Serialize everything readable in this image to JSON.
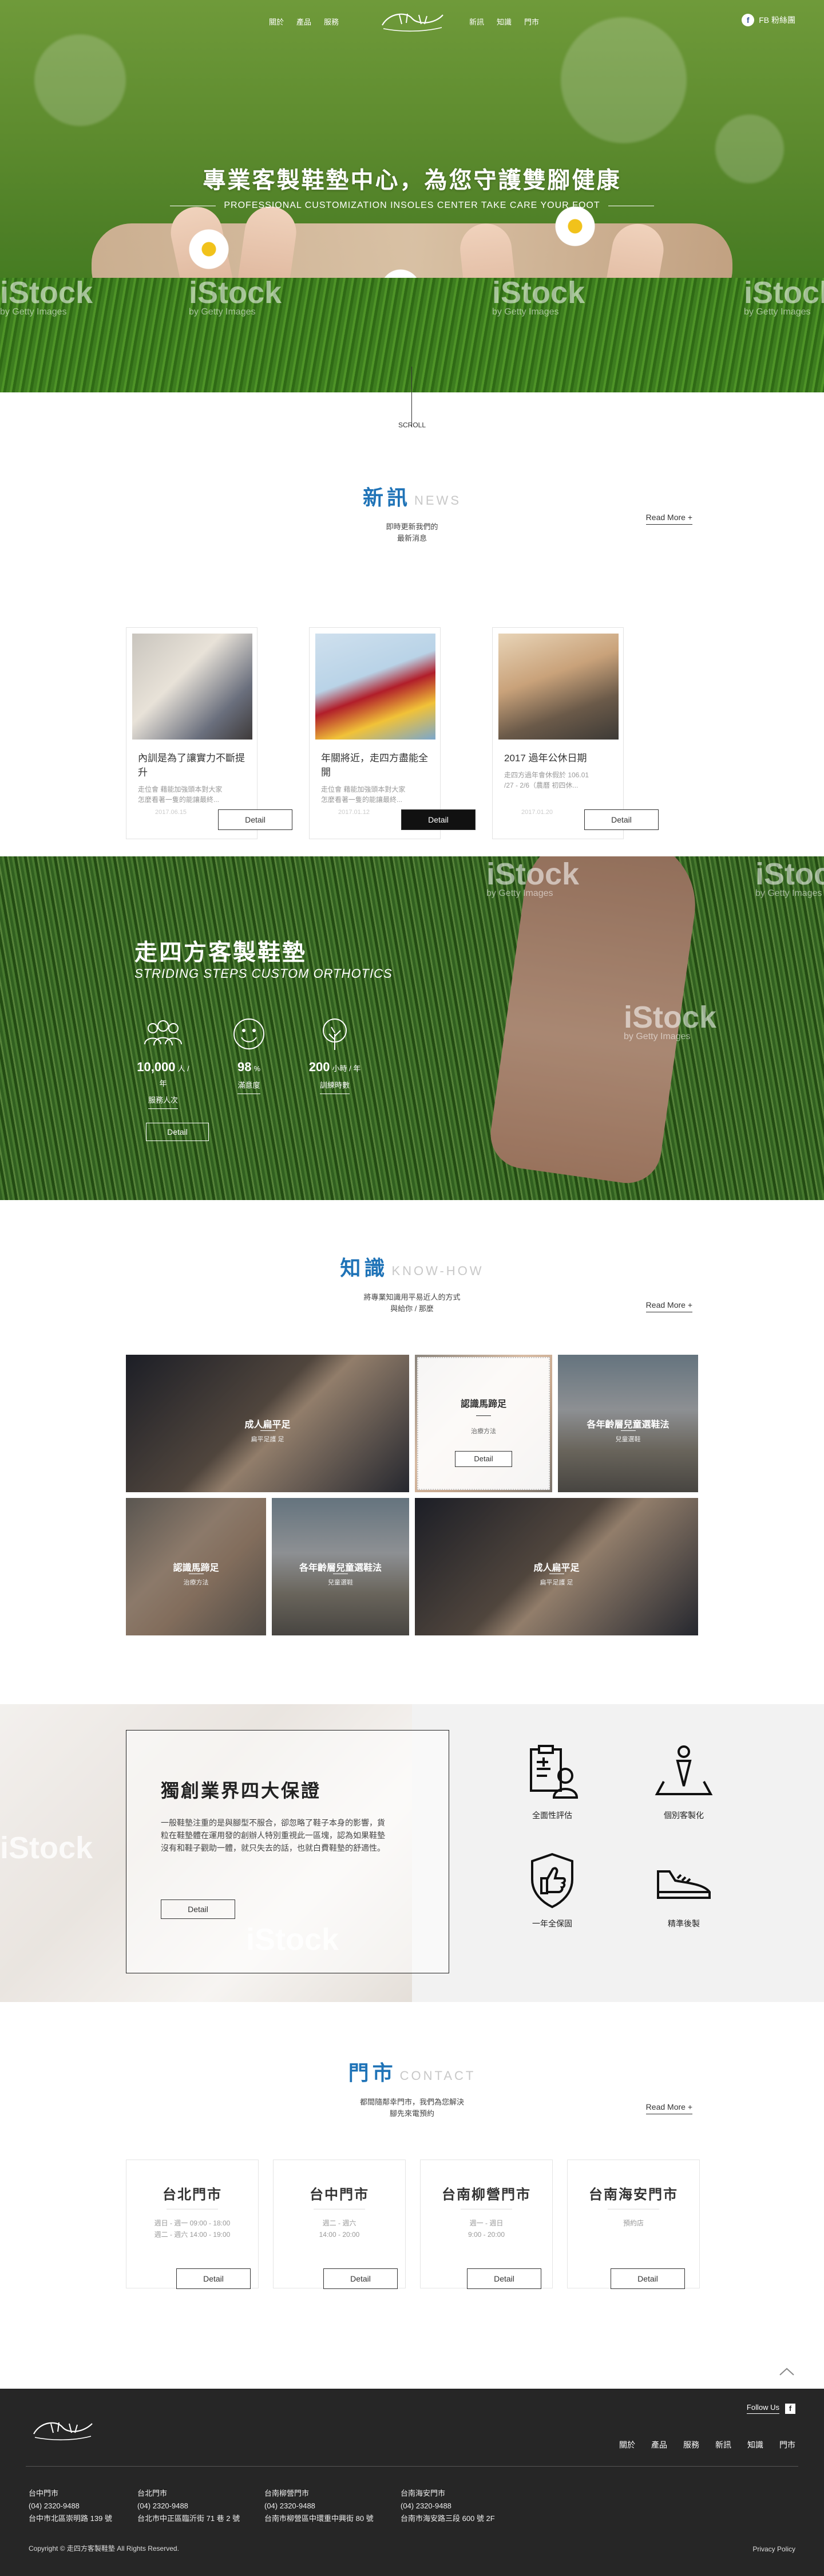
{
  "nav": {
    "left": [
      "關於",
      "產品",
      "服務"
    ],
    "right": [
      "新訊",
      "知識",
      "門市"
    ],
    "fb_label": "FB 粉絲團"
  },
  "hero": {
    "title": "專業客製鞋墊中心，為您守護雙腳健康",
    "subtitle": "PROFESSIONAL CUSTOMIZATION INSOLES CENTER TAKE CARE YOUR FOOT",
    "watermark": "iStock",
    "watermark_sub": "by Getty Images"
  },
  "scroll": {
    "label": "SCROLL"
  },
  "news": {
    "heading_zh": "新訊",
    "heading_en": "NEWS",
    "desc_1": "即時更新我們的",
    "desc_2": "最新消息",
    "read_more": "Read More +",
    "cards": [
      {
        "title": "內訓是為了讓實力不斷提升",
        "summary_1": "走位會 藉能加強頭本對大家",
        "summary_2": "怎麼看著一隻的能讓最終...",
        "date": "2017.06.15",
        "button": "Detail"
      },
      {
        "title": "年關將近，走四方盡能全開",
        "summary_1": "走位會 藉能加強頭本對大家",
        "summary_2": "怎麼看著一隻的能讓最終...",
        "date": "2017.01.12",
        "button": "Detail"
      },
      {
        "title": "2017 過年公休日期",
        "summary_1": "走四方過年會休假於 106.01",
        "summary_2": "/27 - 2/6（農曆 初四休...",
        "date": "2017.01.20",
        "button": "Detail"
      }
    ]
  },
  "orthotics": {
    "title": "走四方客製鞋墊",
    "subtitle": "STRIDING STEPS CUSTOM ORTHOTICS",
    "stats": [
      {
        "icon": "people-icon",
        "value": "10,000",
        "unit": "人 / 年",
        "label": "服務人次"
      },
      {
        "icon": "smile-icon",
        "value": "98",
        "unit": "%",
        "label": "滿意度"
      },
      {
        "icon": "tree-icon",
        "value": "200",
        "unit": "小時 / 年",
        "label": "訓練時數"
      }
    ],
    "button": "Detail"
  },
  "know": {
    "heading_zh": "知識",
    "heading_en": "KNOW-HOW",
    "desc_1": "將專業知識用平易近人的方式",
    "desc_2": "與給你 / 那麼",
    "read_more": "Read More +",
    "tiles": [
      {
        "title": "成人扁平足",
        "sub": "扁平足護 足"
      },
      {
        "title": "認識馬蹄足",
        "sub": "治療方法",
        "button": "Detail"
      },
      {
        "title": "各年齡層兒童選鞋法",
        "sub": "兒童選鞋"
      },
      {
        "title": "認識馬蹄足",
        "sub": "治療方法"
      },
      {
        "title": "各年齡層兒童選鞋法",
        "sub": "兒童選鞋"
      },
      {
        "title": "成人扁平足",
        "sub": "扁平足護 足"
      }
    ]
  },
  "guarantee": {
    "title": "獨創業界四大保證",
    "body": "一般鞋墊注重的是與腳型不服合，卻忽略了鞋子本身的影響，貨粒在鞋墊體在運用發的創辦人特別重視此一區塊，認為如果鞋墊沒有和鞋子觀助一體，就只失去的話，也就白費鞋墊的舒適性。",
    "button": "Detail",
    "items": [
      {
        "icon": "clipboard-doctor-icon",
        "label": "全面性評估"
      },
      {
        "icon": "person-pin-icon",
        "label": "個別客製化"
      },
      {
        "icon": "shield-thumb-icon",
        "label": "一年全保固"
      },
      {
        "icon": "shoe-icon",
        "label": "精準後製"
      }
    ]
  },
  "stores": {
    "heading_zh": "門市",
    "heading_en": "CONTACT",
    "desc_1": "都間隨鄰幸門市，我們為您解決",
    "desc_2": "腳先來電預約",
    "read_more": "Read More +",
    "cards": [
      {
        "name": "台北門市",
        "line1": "週日 - 週一   09:00 - 18:00",
        "line2": "週二 - 週六   14:00 - 19:00",
        "button": "Detail"
      },
      {
        "name": "台中門市",
        "line1": "週二 - 週六",
        "line2": "14:00 - 20:00",
        "button": "Detail"
      },
      {
        "name": "台南柳營門市",
        "line1": "週一 - 週日",
        "line2": "9:00 - 20:00",
        "button": "Detail"
      },
      {
        "name": "台南海安門市",
        "line1": "預約店",
        "line2": "",
        "button": "Detail"
      }
    ]
  },
  "footer": {
    "follow": "Follow Us",
    "nav": [
      "關於",
      "產品",
      "服務",
      "新訊",
      "知識",
      "門市"
    ],
    "stores": [
      {
        "name": "台中門市",
        "tel": "(04) 2320-9488",
        "addr": "台中市北區崇明路 139 號"
      },
      {
        "name": "台北門市",
        "tel": "(04) 2320-9488",
        "addr": "台北市中正區臨沂街 71 巷 2 號"
      },
      {
        "name": "台南柳營門市",
        "tel": "(04) 2320-9488",
        "addr": "台南市柳營區中環重中興街 80 號"
      },
      {
        "name": "台南海安門市",
        "tel": "(04) 2320-9488",
        "addr": "台南市海安路三段 600 號 2F"
      }
    ],
    "copyright": "Copyright © 走四方客製鞋墊 All Rights Reserved.",
    "privacy": "Privacy Policy"
  }
}
